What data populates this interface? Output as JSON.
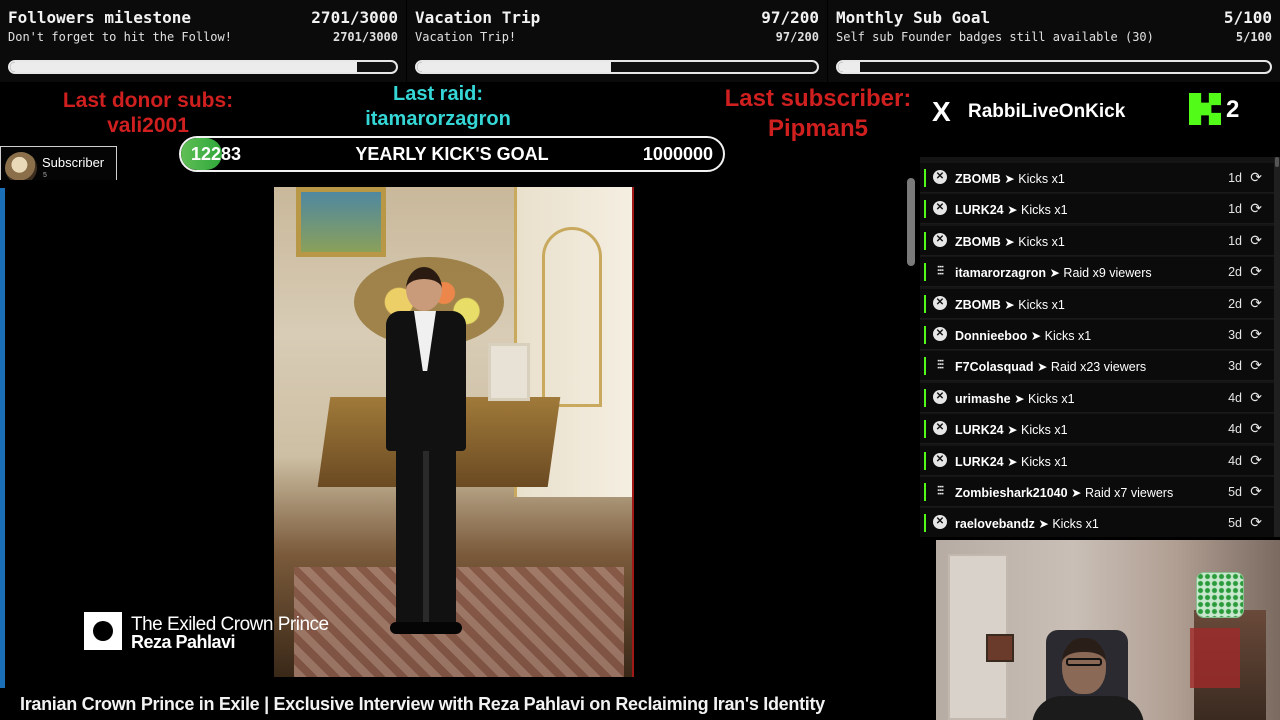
{
  "goals": [
    {
      "title": "Followers milestone",
      "count": "2701/3000",
      "subtitle": "Don't forget to hit the Follow!",
      "subcount": "2701/3000",
      "progress": 0.9
    },
    {
      "title": "Vacation Trip",
      "count": "97/200",
      "subtitle": "Vacation Trip!",
      "subcount": "97/200",
      "progress": 0.485
    },
    {
      "title": "Monthly Sub Goal",
      "count": "5/100",
      "subtitle": "Self sub Founder badges still available (30)",
      "subcount": "5/100",
      "progress": 0.05
    }
  ],
  "last_donor": {
    "label": "Last donor subs:",
    "name": "vali2001"
  },
  "last_raid": {
    "label": "Last raid:",
    "name": "itamarorzagron"
  },
  "last_subscriber": {
    "label": "Last subscriber:",
    "name": "Pipman5"
  },
  "yearly_goal": {
    "current": "12283",
    "title": "YEARLY KICK'S GOAL",
    "target": "1000000",
    "progress": 0.012283
  },
  "subscriber_badge": {
    "label": "Subscriber",
    "count": "5"
  },
  "video": {
    "caption_line1": "The Exiled Crown Prince",
    "caption_line2": "Reza Pahlavi",
    "title": "Iranian Crown Prince in Exile | Exclusive Interview with Reza Pahlavi on Reclaiming Iran's Identity"
  },
  "channel": {
    "x_icon": "X",
    "name": "RabbiLiveOnKick",
    "kick_count": "2"
  },
  "events": [
    {
      "user": "ZBOMB",
      "action": "Kicks x1",
      "age": "1d",
      "type": "kick"
    },
    {
      "user": "LURK24",
      "action": "Kicks x1",
      "age": "1d",
      "type": "kick"
    },
    {
      "user": "ZBOMB",
      "action": "Kicks x1",
      "age": "1d",
      "type": "kick"
    },
    {
      "user": "itamarorzagron",
      "action": "Raid x9 viewers",
      "age": "2d",
      "type": "raid"
    },
    {
      "user": "ZBOMB",
      "action": "Kicks x1",
      "age": "2d",
      "type": "kick"
    },
    {
      "user": "Donnieeboo",
      "action": "Kicks x1",
      "age": "3d",
      "type": "kick"
    },
    {
      "user": "F7Colasquad",
      "action": "Raid x23 viewers",
      "age": "3d",
      "type": "raid"
    },
    {
      "user": "urimashe",
      "action": "Kicks x1",
      "age": "4d",
      "type": "kick"
    },
    {
      "user": "LURK24",
      "action": "Kicks x1",
      "age": "4d",
      "type": "kick"
    },
    {
      "user": "LURK24",
      "action": "Kicks x1",
      "age": "4d",
      "type": "kick"
    },
    {
      "user": "Zombieshark21040",
      "action": "Raid x7 viewers",
      "age": "5d",
      "type": "raid"
    },
    {
      "user": "raelovebandz",
      "action": "Kicks x1",
      "age": "5d",
      "type": "kick"
    }
  ],
  "colors": {
    "accent_green": "#53fc18",
    "red_text": "#cf1f1f",
    "cyan_text": "#35d6d6",
    "video_edge": "#1b6fb7"
  }
}
